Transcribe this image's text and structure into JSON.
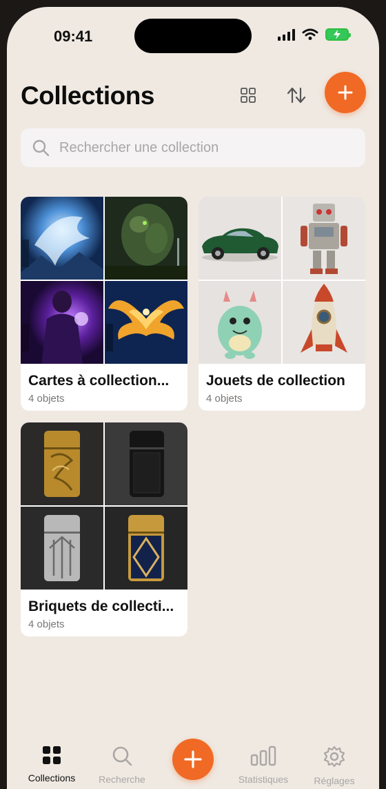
{
  "status": {
    "time": "09:41"
  },
  "header": {
    "title": "Collections",
    "accent": "#f06a25"
  },
  "search": {
    "placeholder": "Rechercher une collection"
  },
  "collections": [
    {
      "name": "Cartes à collection...",
      "count": "4 objets",
      "thumbs": [
        "ice-dragon-card",
        "forest-golem-card",
        "sorceress-card",
        "phoenix-card"
      ]
    },
    {
      "name": "Jouets de collection",
      "count": "4 objets",
      "thumbs": [
        "green-toy-car",
        "tin-robot",
        "monster-figurine",
        "tin-rocket"
      ]
    },
    {
      "name": "Briquets de collecti...",
      "count": "4 objets",
      "thumbs": [
        "gold-engraved-lighter",
        "black-lighter",
        "silver-deco-lighter",
        "blue-gold-lighter"
      ]
    }
  ],
  "tabbar": {
    "items": [
      {
        "label": "Collections",
        "icon": "grid-icon",
        "active": true
      },
      {
        "label": "Recherche",
        "icon": "search-icon",
        "active": false
      },
      {
        "label": "Statistiques",
        "icon": "bar-chart-icon",
        "active": false
      },
      {
        "label": "Réglages",
        "icon": "gear-icon",
        "active": false
      }
    ]
  }
}
